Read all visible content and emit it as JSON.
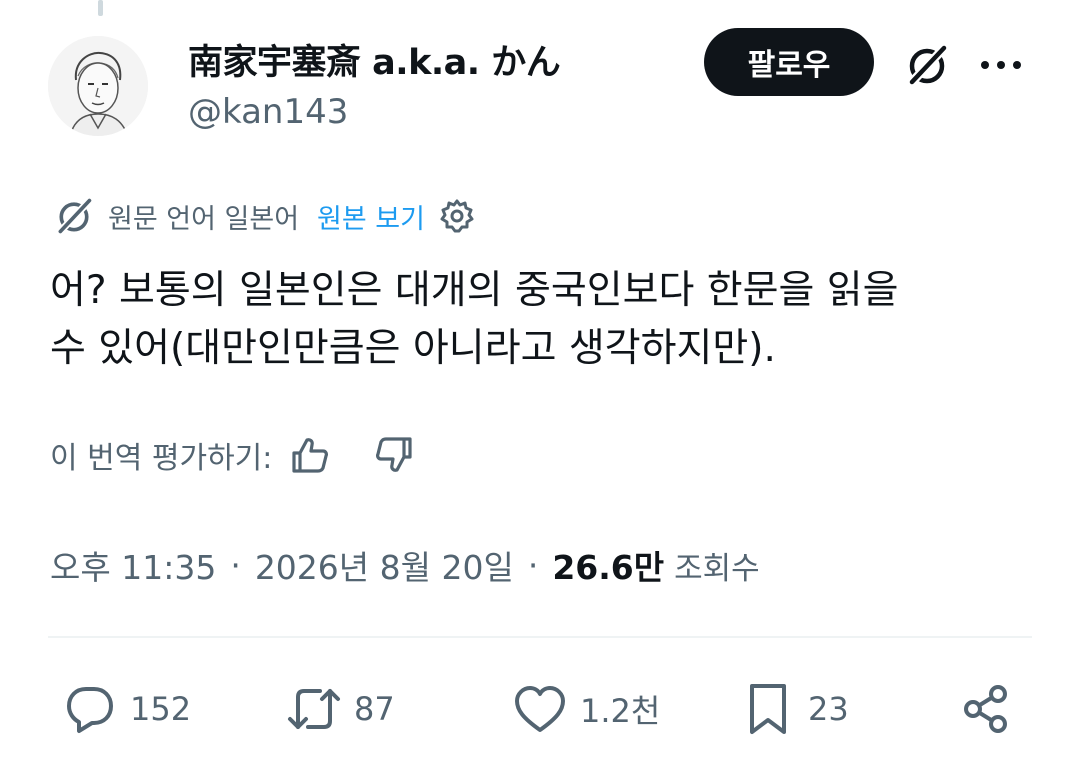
{
  "author": {
    "display_name": "南家宇塞斎 a.k.a. かん",
    "handle": "@kan143"
  },
  "header": {
    "follow_label": "팔로우"
  },
  "translation": {
    "label": "원문 언어 일본어",
    "show_original": "원본 보기"
  },
  "tweet": {
    "line1": "어? 보통의 일본인은 대개의 중국인보다 한문을 읽을",
    "line2": "수 있어(대만인만큼은 아니라고 생각하지만)."
  },
  "rating": {
    "label": "이 번역 평가하기:"
  },
  "meta": {
    "time": "오후 11:35",
    "date": "2026년 8월 20일",
    "views_count": "26.6만",
    "views_label": "조회수",
    "separator": "·"
  },
  "actions": {
    "replies": "152",
    "reposts": "87",
    "likes": "1.2천",
    "bookmarks": "23"
  },
  "colors": {
    "text": "#0f1419",
    "secondary": "#536471",
    "link": "#1d9bf0",
    "divider": "#eff3f4"
  },
  "icons": [
    "grok-icon",
    "more-icon",
    "translate-icon",
    "gear-icon",
    "thumbs-up-icon",
    "thumbs-down-icon",
    "reply-icon",
    "repost-icon",
    "like-icon",
    "bookmark-icon",
    "share-icon"
  ]
}
